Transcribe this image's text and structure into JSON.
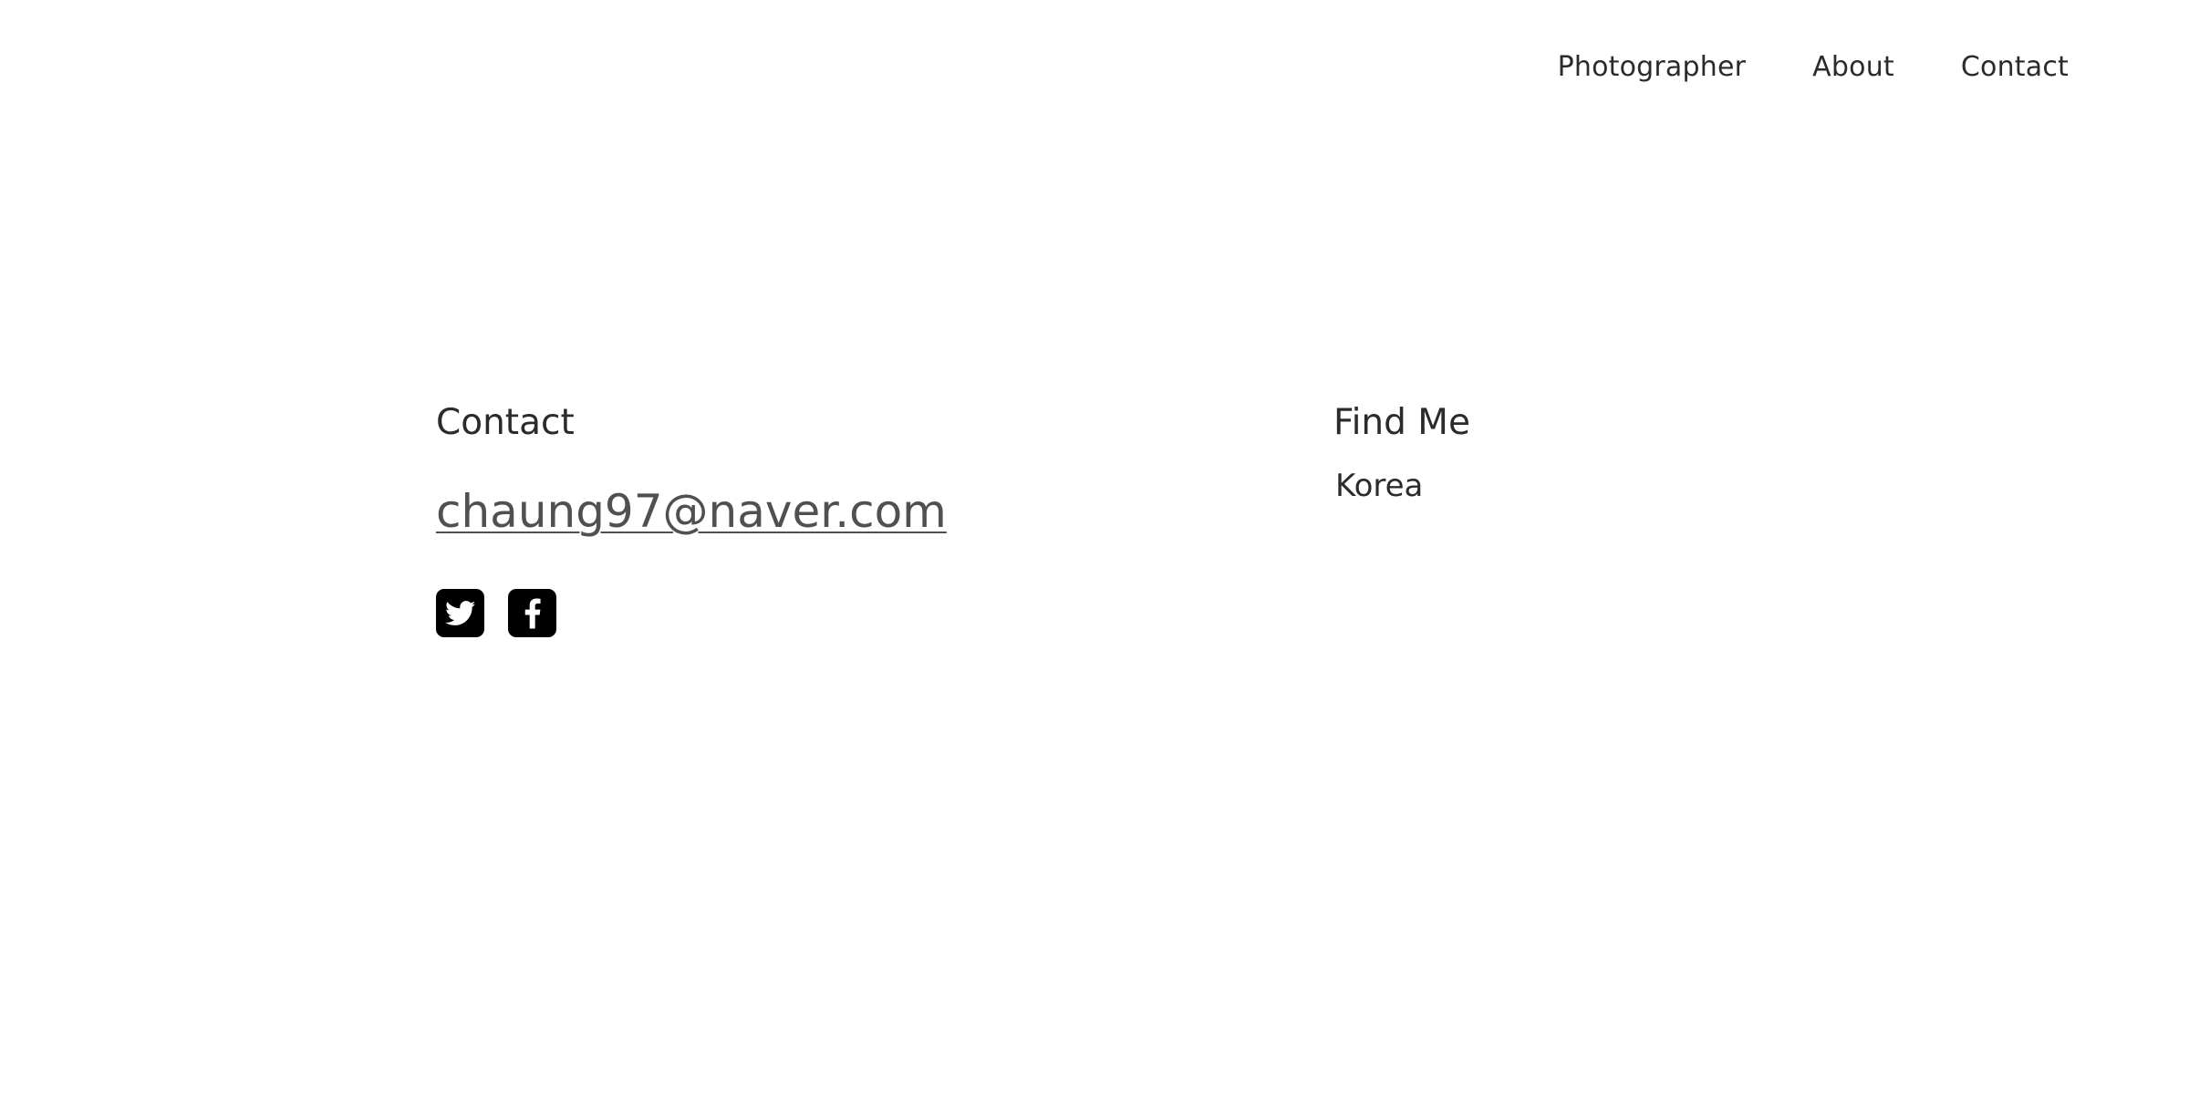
{
  "nav": {
    "items": [
      {
        "label": "Photographer"
      },
      {
        "label": "About"
      },
      {
        "label": "Contact"
      }
    ]
  },
  "contact": {
    "heading": "Contact",
    "email": "chaung97@naver.com",
    "socials": [
      {
        "icon": "twitter-icon"
      },
      {
        "icon": "facebook-icon"
      }
    ]
  },
  "find_me": {
    "heading": "Find Me",
    "location": "Korea"
  },
  "colors": {
    "text": "#2b2b2b",
    "email": "#505050",
    "social_bg": "#000000",
    "background": "#ffffff"
  }
}
